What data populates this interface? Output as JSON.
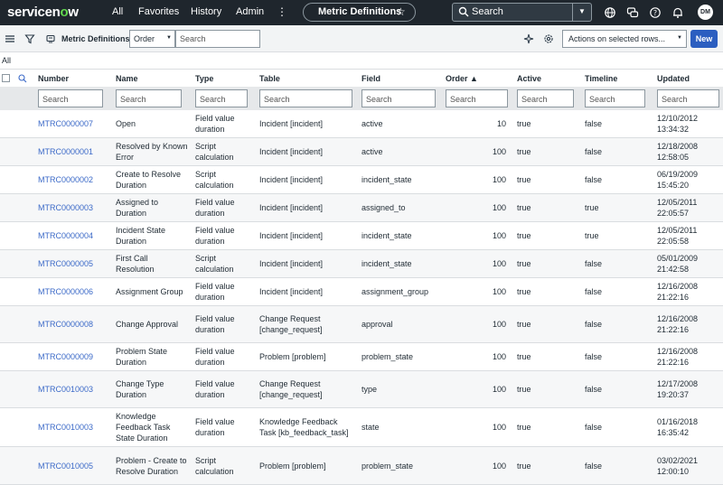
{
  "topnav": {
    "logo_a": "servicen",
    "logo_o": "o",
    "logo_b": "w",
    "links": [
      "All",
      "Favorites",
      "History",
      "Admin"
    ],
    "kebab": "⋮",
    "context_title": "Metric Definitions",
    "star": "☆",
    "search_placeholder": "Search",
    "search_caret": "▼",
    "avatar_initials": "DM"
  },
  "toolbar": {
    "title": "Metric Definitions",
    "field_select": "Order",
    "select_caret": "▼",
    "search_placeholder": "Search",
    "actions_label": "Actions on selected rows...",
    "actions_caret": "▼",
    "new_label": "New"
  },
  "breadcrumb": "All",
  "table": {
    "headers": {
      "number": "Number",
      "name": "Name",
      "type": "Type",
      "table": "Table",
      "field": "Field",
      "order": "Order ▲",
      "active": "Active",
      "timeline": "Timeline",
      "updated": "Updated"
    },
    "filter_placeholder": "Search",
    "rows": [
      {
        "number": "MTRC0000007",
        "name": "Open",
        "type": "Field value duration",
        "table": "Incident [incident]",
        "field": "active",
        "order": "10",
        "active": "true",
        "timeline": "false",
        "updated": "12/10/2012 13:34:32"
      },
      {
        "number": "MTRC0000001",
        "name": "Resolved by Known Error",
        "type": "Script calculation",
        "table": "Incident [incident]",
        "field": "active",
        "order": "100",
        "active": "true",
        "timeline": "false",
        "updated": "12/18/2008 12:58:05"
      },
      {
        "number": "MTRC0000002",
        "name": "Create to Resolve Duration",
        "type": "Script calculation",
        "table": "Incident [incident]",
        "field": "incident_state",
        "order": "100",
        "active": "true",
        "timeline": "false",
        "updated": "06/19/2009 15:45:20"
      },
      {
        "number": "MTRC0000003",
        "name": "Assigned to Duration",
        "type": "Field value duration",
        "table": "Incident [incident]",
        "field": "assigned_to",
        "order": "100",
        "active": "true",
        "timeline": "true",
        "updated": "12/05/2011 22:05:57"
      },
      {
        "number": "MTRC0000004",
        "name": "Incident State Duration",
        "type": "Field value duration",
        "table": "Incident [incident]",
        "field": "incident_state",
        "order": "100",
        "active": "true",
        "timeline": "true",
        "updated": "12/05/2011 22:05:58"
      },
      {
        "number": "MTRC0000005",
        "name": "First Call Resolution",
        "type": "Script calculation",
        "table": "Incident [incident]",
        "field": "incident_state",
        "order": "100",
        "active": "true",
        "timeline": "false",
        "updated": "05/01/2009 21:42:58"
      },
      {
        "number": "MTRC0000006",
        "name": "Assignment Group",
        "type": "Field value duration",
        "table": "Incident [incident]",
        "field": "assignment_group",
        "order": "100",
        "active": "true",
        "timeline": "false",
        "updated": "12/16/2008 21:22:16"
      },
      {
        "number": "MTRC0000008",
        "name": "Change Approval",
        "type": "Field value duration",
        "table": "Change Request [change_request]",
        "field": "approval",
        "order": "100",
        "active": "true",
        "timeline": "false",
        "updated": "12/16/2008 21:22:16"
      },
      {
        "number": "MTRC0000009",
        "name": "Problem State Duration",
        "type": "Field value duration",
        "table": "Problem [problem]",
        "field": "problem_state",
        "order": "100",
        "active": "true",
        "timeline": "false",
        "updated": "12/16/2008 21:22:16"
      },
      {
        "number": "MTRC0010003",
        "name": "Change Type Duration",
        "type": "Field value duration",
        "table": "Change Request [change_request]",
        "field": "type",
        "order": "100",
        "active": "true",
        "timeline": "false",
        "updated": "12/17/2008 19:20:37"
      },
      {
        "number": "MTRC0010003",
        "name": "Knowledge Feedback Task State Duration",
        "type": "Field value duration",
        "table": "Knowledge Feedback Task [kb_feedback_task]",
        "field": "state",
        "order": "100",
        "active": "true",
        "timeline": "false",
        "updated": "01/16/2018 16:35:42"
      },
      {
        "number": "MTRC0010005",
        "name": "Problem - Create to Resolve Duration",
        "type": "Script calculation",
        "table": "Problem [problem]",
        "field": "problem_state",
        "order": "100",
        "active": "true",
        "timeline": "false",
        "updated": "03/02/2021 12:00:10"
      }
    ]
  }
}
